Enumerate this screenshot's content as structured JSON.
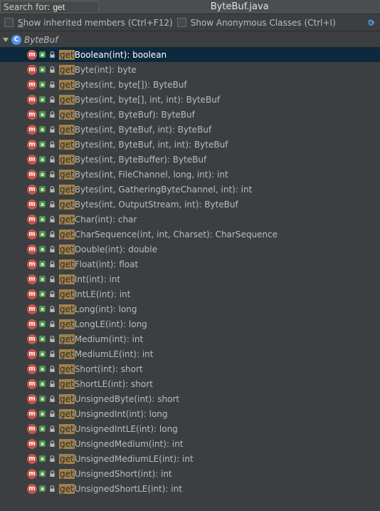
{
  "search": {
    "label": "Search for:",
    "value": "get"
  },
  "file_tab": "ByteBuf.java",
  "options": {
    "inherited_pre": "S",
    "inherited_mid": "how inherited members",
    "inherited_hint": "(Ctrl+F12)",
    "anon": "Show Anonymous Classes",
    "anon_hint": "(Ctrl+I)"
  },
  "root": {
    "name": "ByteBuf"
  },
  "methods": [
    {
      "hl": "get",
      "rest": "Boolean(int): boolean",
      "selected": true
    },
    {
      "hl": "get",
      "rest": "Byte(int): byte"
    },
    {
      "hl": "get",
      "rest": "Bytes(int, byte[]): ByteBuf"
    },
    {
      "hl": "get",
      "rest": "Bytes(int, byte[], int, int): ByteBuf"
    },
    {
      "hl": "get",
      "rest": "Bytes(int, ByteBuf): ByteBuf"
    },
    {
      "hl": "get",
      "rest": "Bytes(int, ByteBuf, int): ByteBuf"
    },
    {
      "hl": "get",
      "rest": "Bytes(int, ByteBuf, int, int): ByteBuf"
    },
    {
      "hl": "get",
      "rest": "Bytes(int, ByteBuffer): ByteBuf"
    },
    {
      "hl": "get",
      "rest": "Bytes(int, FileChannel, long, int): int"
    },
    {
      "hl": "get",
      "rest": "Bytes(int, GatheringByteChannel, int): int"
    },
    {
      "hl": "get",
      "rest": "Bytes(int, OutputStream, int): ByteBuf"
    },
    {
      "hl": "get",
      "rest": "Char(int): char"
    },
    {
      "hl": "get",
      "rest": "CharSequence(int, int, Charset): CharSequence"
    },
    {
      "hl": "get",
      "rest": "Double(int): double"
    },
    {
      "hl": "get",
      "rest": "Float(int): float"
    },
    {
      "hl": "get",
      "rest": "Int(int): int"
    },
    {
      "hl": "get",
      "rest": "IntLE(int): int"
    },
    {
      "hl": "get",
      "rest": "Long(int): long"
    },
    {
      "hl": "get",
      "rest": "LongLE(int): long"
    },
    {
      "hl": "get",
      "rest": "Medium(int): int"
    },
    {
      "hl": "get",
      "rest": "MediumLE(int): int"
    },
    {
      "hl": "get",
      "rest": "Short(int): short"
    },
    {
      "hl": "get",
      "rest": "ShortLE(int): short"
    },
    {
      "hl": "get",
      "rest": "UnsignedByte(int): short"
    },
    {
      "hl": "get",
      "rest": "UnsignedInt(int): long"
    },
    {
      "hl": "get",
      "rest": "UnsignedIntLE(int): long"
    },
    {
      "hl": "get",
      "rest": "UnsignedMedium(int): int"
    },
    {
      "hl": "get",
      "rest": "UnsignedMediumLE(int): int"
    },
    {
      "hl": "get",
      "rest": "UnsignedShort(int): int"
    },
    {
      "hl": "get",
      "rest": "UnsignedShortLE(int): int"
    }
  ]
}
